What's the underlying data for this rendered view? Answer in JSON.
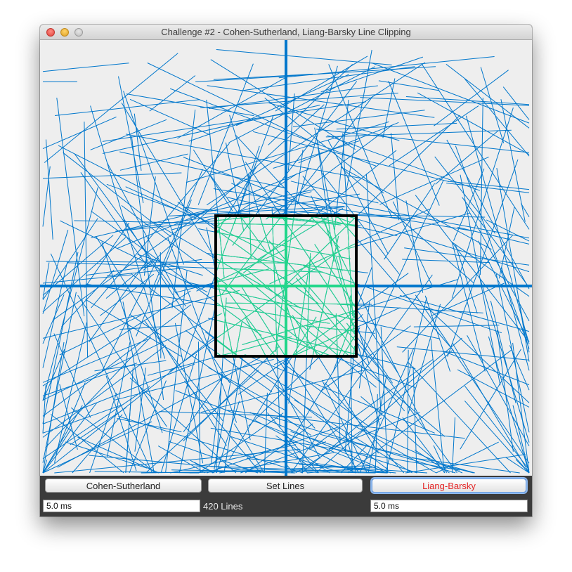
{
  "window": {
    "title": "Challenge #2 - Cohen-Sutherland, Liang-Barsky Line Clipping"
  },
  "canvas": {
    "line_count": 420,
    "colors": {
      "background": "#eeeeee",
      "line": "#0077cc",
      "clipped_line": "#22d68a",
      "axes": "#0077cc",
      "clip_window_border": "#000000"
    }
  },
  "controls": {
    "cohen_sutherland_label": "Cohen-Sutherland",
    "set_lines_label": "Set Lines",
    "liang_barsky_label": "Liang-Barsky",
    "cohen_sutherland_time": "5.0 ms",
    "liang_barsky_time": "5.0 ms",
    "line_count_text": "420 Lines"
  }
}
